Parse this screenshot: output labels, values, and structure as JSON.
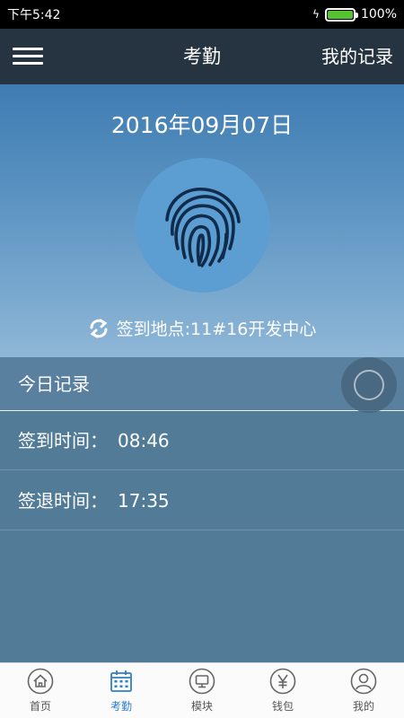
{
  "status_bar": {
    "time": "下午5:42",
    "battery_percent": "100%",
    "battery_level": 1.0
  },
  "header": {
    "title": "考勤",
    "records_link": "我的记录",
    "menu_icon": "hamburger-menu-icon"
  },
  "checkin": {
    "date": "2016年09月07日",
    "fingerprint_icon": "fingerprint-icon",
    "location_label": "签到地点:11#16开发中心",
    "refresh_icon": "refresh-icon"
  },
  "records": {
    "header": "今日记录",
    "rows": [
      {
        "label": "签到时间：",
        "value": "08:46"
      },
      {
        "label": "签退时间：",
        "value": "17:35"
      }
    ]
  },
  "tabs": [
    {
      "label": "首页",
      "icon": "home-icon",
      "active": false
    },
    {
      "label": "考勤",
      "icon": "calendar-icon",
      "active": true
    },
    {
      "label": "模块",
      "icon": "monitor-icon",
      "active": false
    },
    {
      "label": "钱包",
      "icon": "wallet-yen-icon",
      "active": false
    },
    {
      "label": "我的",
      "icon": "user-icon",
      "active": false
    }
  ],
  "colors": {
    "app_bar": "#253440",
    "accent": "#2f7fc8",
    "battery": "#55c22f",
    "hero_top": "#3f7cb2",
    "records_bg": "#527b98"
  }
}
